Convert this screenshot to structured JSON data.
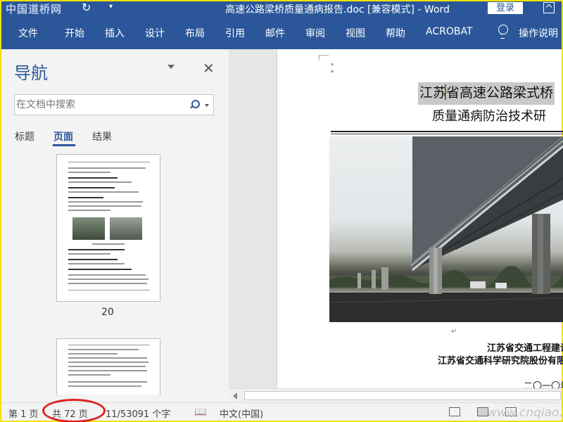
{
  "titlebar": {
    "watermark": "中国道桥网",
    "doc_title": "高速公路梁桥质量通病报告.doc [兼容模式] - Word",
    "login_label": "登录"
  },
  "ribbon": {
    "tabs": [
      "文件",
      "开始",
      "插入",
      "设计",
      "布局",
      "引用",
      "邮件",
      "审阅",
      "视图",
      "帮助",
      "ACROBAT"
    ],
    "tell_me": "操作说明"
  },
  "nav_pane": {
    "title": "导航",
    "search_placeholder": "在文档中搜索",
    "tabs": [
      "标题",
      "页面",
      "结果"
    ],
    "active_tab": "页面",
    "thumbnail_page": "20"
  },
  "document": {
    "heading_line1": "江苏省高速公路梁式桥",
    "heading_line2": "质量通病防治技术研",
    "org_line1": "江苏省交通工程建设",
    "org_line2": "江苏省交通科学研究院股份有限公",
    "date": "二〇一〇年"
  },
  "status_bar": {
    "page": "第 1 页",
    "total_pages": "共 72 页",
    "word_count": "11/53091 个字",
    "language": "中文(中国)",
    "site_watermark": "www.cnqiao.com"
  },
  "colors": {
    "ribbon_blue": "#2b579a",
    "highlight_ring": "#e02020",
    "frame_yellow": "#f2e200"
  }
}
